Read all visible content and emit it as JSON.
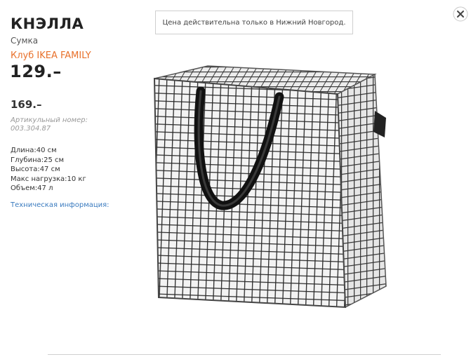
{
  "product": {
    "name": "КНЭЛЛА",
    "type": "Сумка",
    "family_label": "Клуб IKEA FAMILY",
    "family_price": "129.–",
    "regular_price": "169.–",
    "article_label": "Артикульный номер:",
    "article_number": "003.304.87"
  },
  "specs": [
    "Длина:40 см",
    "Глубина:25 см",
    "Высота:47 см",
    "Макс нагрузка:10 кг",
    "Объем:47 л"
  ],
  "tech_link": "Техническая информация:",
  "notice": "Цена действительна только в Нижний Новгород.",
  "colors": {
    "family_accent": "#e8702a",
    "link": "#3a7bbf"
  },
  "icons": {
    "close": "close-icon"
  }
}
